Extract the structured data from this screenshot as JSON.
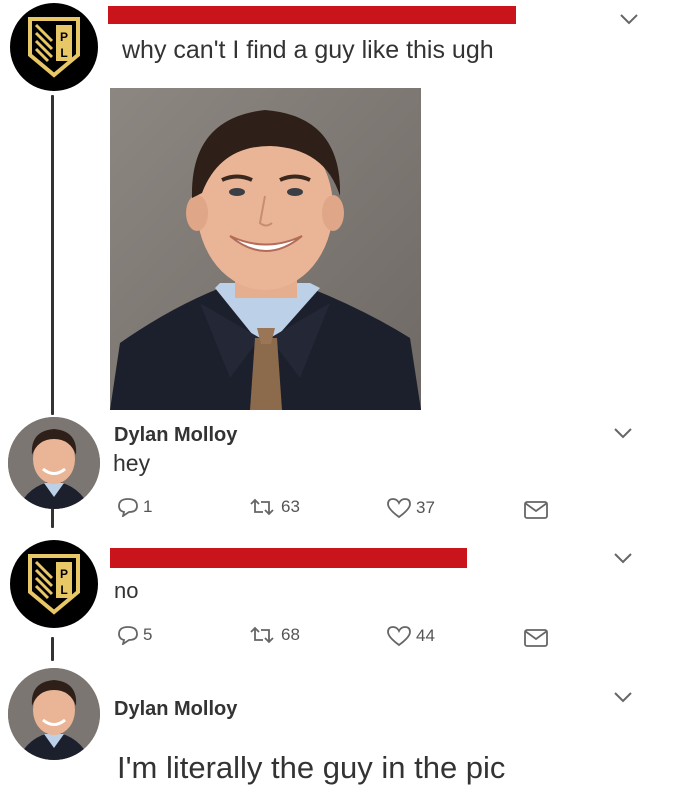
{
  "tweets": [
    {
      "text": "why can't I find a guy like this ugh",
      "avatar_icon": "pll-logo-icon"
    },
    {
      "name": "Dylan Molloy",
      "text": "hey",
      "replies": "1",
      "retweets": "63",
      "likes": "37"
    },
    {
      "text": "no",
      "avatar_icon": "pll-logo-icon",
      "replies": "5",
      "retweets": "68",
      "likes": "44"
    },
    {
      "name": "Dylan Molloy",
      "text": "I'm literally the guy in the pic"
    }
  ],
  "colors": {
    "redaction": "#c8141a",
    "logo_gold": "#e8c766",
    "text": "#333333"
  }
}
